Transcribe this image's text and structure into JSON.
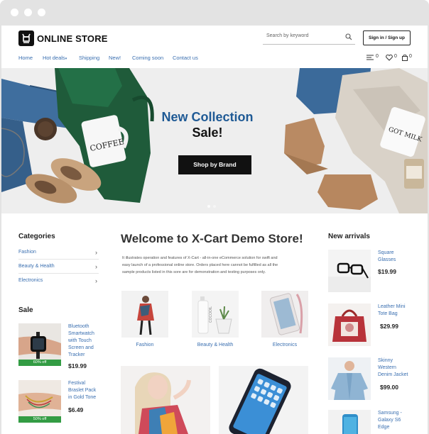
{
  "header": {
    "logo_text": "ONLINE STORE",
    "search_placeholder": "Search by keyword",
    "signin_label": "Sign in / Sign up"
  },
  "nav": {
    "items": [
      "Home",
      "Hot deals",
      "Shipping",
      "New!",
      "Coming soon",
      "Contact us"
    ],
    "hot_deals_caret": "▾"
  },
  "tools": {
    "compare_count": "0",
    "wishlist_count": "0",
    "cart_count": "0"
  },
  "hero": {
    "title": "New Collection",
    "subtitle": "Sale!",
    "button": "Shop by Brand",
    "mug_left_text": "COFFEE",
    "mug_right_text": "GOT MILK"
  },
  "categories": {
    "heading": "Categories",
    "items": [
      "Fashion",
      "Beauty & Health",
      "Electronics"
    ]
  },
  "sale": {
    "heading": "Sale",
    "items": [
      {
        "name_lines": [
          "Bluetooth",
          "Smartwatch",
          "with Touch",
          "Screen and",
          "Tracker"
        ],
        "badge": "60% off",
        "price": "$19.99"
      },
      {
        "name_lines": [
          "Festival",
          "Braslet Pack",
          "in Gold Tone"
        ],
        "badge": "50% off",
        "price": "$6.49"
      }
    ]
  },
  "main": {
    "welcome": "Welcome to X-Cart Demo Store!",
    "intro_lines": [
      "It illustrates operation and features of X-Cart - all-in-one eCommerce solution for swift and",
      "easy launch of a professional online store. Orders placed here cannot be fulfilled as all the",
      "sample products listed in this sore are for demonstration and testing purposes only."
    ],
    "category_tiles": [
      "Fashion",
      "Beauty & Health",
      "Electronics"
    ],
    "bottle_label": "COCOOIL"
  },
  "new_arrivals": {
    "heading": "New arrivals",
    "items": [
      {
        "name_lines": [
          "Square",
          "Glasses"
        ],
        "price": "$19.99"
      },
      {
        "name_lines": [
          "Leather Mini",
          "Tote Bag"
        ],
        "price": "$29.99"
      },
      {
        "name_lines": [
          "Skinny",
          "Western",
          "Denim Jacket"
        ],
        "price": "$99.00"
      },
      {
        "name_lines": [
          "Samsung -",
          "Galaxy S6",
          "Edge"
        ],
        "price": ""
      }
    ]
  },
  "colors": {
    "link": "#3a6fb0",
    "hero_title": "#1f5a95",
    "sale_badge": "#339c44",
    "hero_button": "#111111"
  }
}
